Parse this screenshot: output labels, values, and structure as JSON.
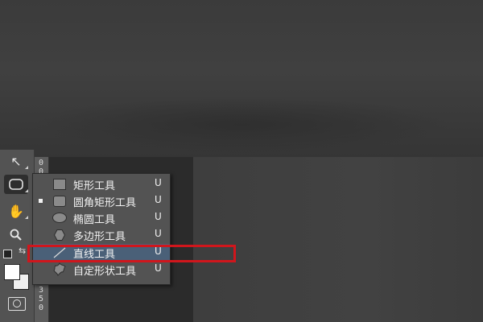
{
  "ruler": {
    "digits_top": [
      "0",
      "0"
    ],
    "digits_bottom": [
      "3",
      "5",
      "0"
    ]
  },
  "toolbar": {
    "tools": [
      {
        "name": "move-tool",
        "icon": "arrow-cursor-icon",
        "glyph": "↖"
      },
      {
        "name": "shape-tool",
        "icon": "rounded-rectangle-icon",
        "glyph": "▢"
      },
      {
        "name": "hand-tool",
        "icon": "hand-icon",
        "glyph": "✋"
      },
      {
        "name": "zoom-tool",
        "icon": "magnifier-icon",
        "glyph": "🔍"
      }
    ],
    "swap_glyph": "⇆",
    "foreground_color": "#ffffff",
    "background_color": "#f0f0f0"
  },
  "shape_menu": {
    "items": [
      {
        "label": "矩形工具",
        "shortcut": "U",
        "icon": "rectangle-icon",
        "active": false,
        "highlighted": false
      },
      {
        "label": "圆角矩形工具",
        "shortcut": "U",
        "icon": "rounded-rectangle-icon",
        "active": true,
        "highlighted": false
      },
      {
        "label": "椭圆工具",
        "shortcut": "U",
        "icon": "ellipse-icon",
        "active": false,
        "highlighted": false
      },
      {
        "label": "多边形工具",
        "shortcut": "U",
        "icon": "polygon-icon",
        "active": false,
        "highlighted": false
      },
      {
        "label": "直线工具",
        "shortcut": "U",
        "icon": "line-icon",
        "active": false,
        "highlighted": true
      },
      {
        "label": "自定形状工具",
        "shortcut": "U",
        "icon": "custom-shape-icon",
        "active": false,
        "highlighted": false
      }
    ]
  },
  "colors": {
    "highlight_frame": "#d0161c",
    "selection": "#4a6078",
    "panel": "#535353"
  }
}
